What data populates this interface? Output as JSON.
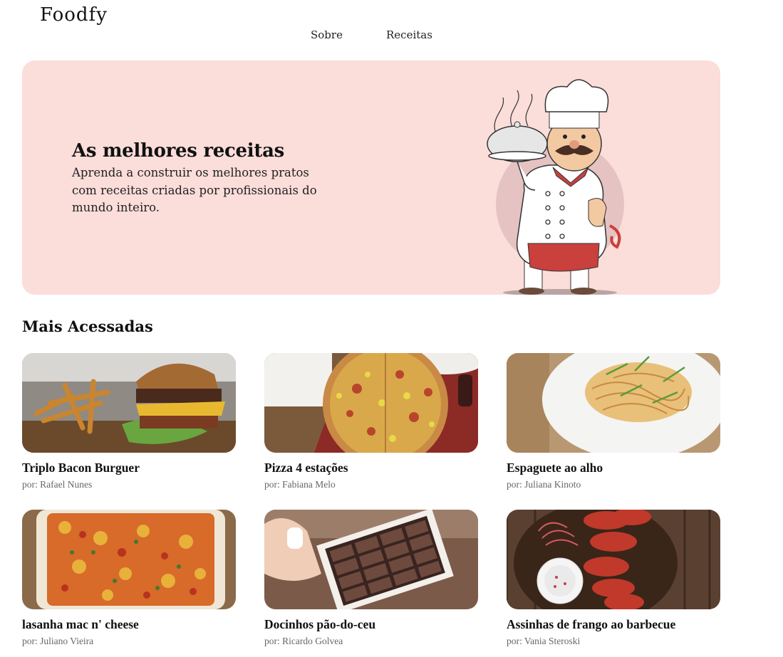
{
  "header": {
    "logo": "Foodfy",
    "nav": [
      {
        "label": "Sobre"
      },
      {
        "label": "Receitas"
      }
    ]
  },
  "hero": {
    "title": "As melhores receitas",
    "text": "Aprenda a construir os melhores pratos com receitas criadas por profissionais do mundo inteiro.",
    "background": "#fbddda"
  },
  "section": {
    "title": "Mais Acessadas"
  },
  "recipes": [
    {
      "title": "Triplo Bacon Burguer",
      "author": "por: Rafael Nunes"
    },
    {
      "title": "Pizza 4 estações",
      "author": "por: Fabiana Melo"
    },
    {
      "title": "Espaguete ao alho",
      "author": "por: Juliana Kinoto"
    },
    {
      "title": "lasanha mac n' cheese",
      "author": "por: Juliano Vieira"
    },
    {
      "title": "Docinhos pão-do-ceu",
      "author": "por: Ricardo Golvea"
    },
    {
      "title": "Assinhas de frango ao barbecue",
      "author": "por: Vania Steroski"
    }
  ]
}
